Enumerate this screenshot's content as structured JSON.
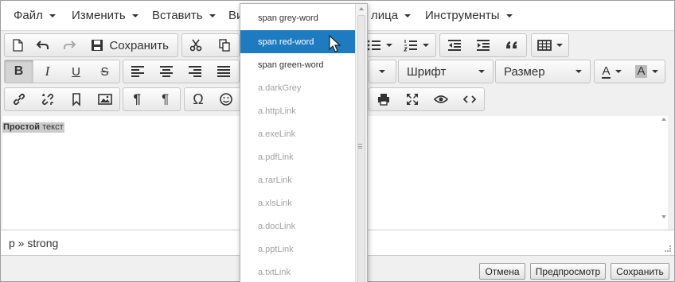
{
  "menubar": {
    "items": [
      {
        "label": "Файл"
      },
      {
        "label": "Изменить"
      },
      {
        "label": "Вставить"
      },
      {
        "label": "Ви"
      },
      {
        "label": "лица"
      },
      {
        "label": "Инструменты"
      }
    ]
  },
  "toolbar": {
    "save_label": "Сохранить",
    "font_label": "Шрифт",
    "size_label": "Размер"
  },
  "content": {
    "bold_text": "Простой",
    "plain_text": " текст"
  },
  "statusbar": {
    "path": "p » strong"
  },
  "footer": {
    "cancel": "Отмена",
    "preview": "Предпросмотр",
    "save": "Сохранить"
  },
  "dropdown": {
    "items": [
      {
        "label": "span grey-word"
      },
      {
        "label": "span red-word"
      },
      {
        "label": "span green-word"
      },
      {
        "label": "a.darkGrey"
      },
      {
        "label": "a.httpLink"
      },
      {
        "label": "a.exeLink"
      },
      {
        "label": "a.pdfLink"
      },
      {
        "label": "a.rarLink"
      },
      {
        "label": "a.xlsLink"
      },
      {
        "label": "a.docLink"
      },
      {
        "label": "a.pptLink"
      },
      {
        "label": "a.txtLink"
      }
    ],
    "highlight_color": "#1f7bc0"
  },
  "colors": {
    "toolbar_bg": "#f0f0f0",
    "border": "#c5c5c5",
    "text": "#333333"
  }
}
